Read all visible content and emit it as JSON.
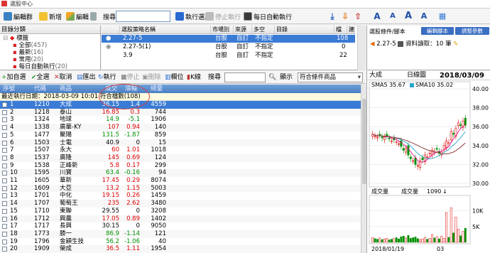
{
  "window": {
    "title": "選股中心"
  },
  "toolbar": {
    "new_folder": "編輯群",
    "add": "新增",
    "edit": "編輯",
    "delete_icon": "trash-icon",
    "search_label": "搜尋",
    "search_value": "",
    "run": "執行選股",
    "stop": "停止執行",
    "auto_run": "每日自動執行"
  },
  "catalog": {
    "header": "目錄分類",
    "root": "標籤",
    "items": [
      {
        "label": "全部",
        "count": "(457)"
      },
      {
        "label": "最新",
        "count": "(16)"
      },
      {
        "label": "常用",
        "count": "(20)"
      },
      {
        "label": "每日自動執行",
        "count": "(20)"
      }
    ]
  },
  "strategy": {
    "headers": [
      "選股策略名稱",
      "市場別",
      "來源",
      "多空",
      "目錄",
      "檔數",
      "建立"
    ],
    "rows": [
      {
        "name": "2.27-5",
        "market": "台股",
        "source": "自訂",
        "side": "不指定",
        "folder": "",
        "count": "108",
        "selected": true
      },
      {
        "name": "2.27-5(1)",
        "market": "台股",
        "source": "自訂",
        "side": "不指定",
        "folder": "",
        "count": "0",
        "selected": false
      },
      {
        "name": "3.9",
        "market": "台股",
        "source": "自訂",
        "side": "不指定",
        "folder": "",
        "count": "22",
        "selected": false
      }
    ]
  },
  "right_top": {
    "header": "選股條件/腳本",
    "btn_edit": "編輯腳本",
    "btn_param": "調整參數",
    "script_name": "2.27-5",
    "read_text": "資料讀取：10 筆"
  },
  "quote_toolbar": {
    "add_group": "加自選",
    "select_all": "全選",
    "cancel": "取消",
    "export": "匯出",
    "run": "執行",
    "stop": "停止",
    "delete": "刪除",
    "column": "欄位",
    "kline": "K線",
    "search": "搜尋",
    "display_label": "顯示",
    "display_value": "符合條件商品"
  },
  "list": {
    "headers": [
      "序號",
      "代碼",
      "商品",
      "成交",
      "漲幅",
      "總量"
    ],
    "update_bar": "最近執行日期：2018-03-09 10:01 符合檔數(108)",
    "rows": [
      {
        "n": "1",
        "code": "1210",
        "name": "大成",
        "price": "36.15",
        "chg": "1.4",
        "vol": "4559",
        "dir": "up",
        "sel": true
      },
      {
        "n": "2",
        "code": "1218",
        "name": "泰山",
        "price": "16.85",
        "chg": "0.3",
        "vol": "744",
        "dir": "up"
      },
      {
        "n": "3",
        "code": "1324",
        "name": "地球",
        "price": "14.9",
        "chg": "-5.1",
        "vol": "1906",
        "dir": "dn"
      },
      {
        "n": "4",
        "code": "1338",
        "name": "廣華-KY",
        "price": "107",
        "chg": "0.94",
        "vol": "140",
        "dir": "up"
      },
      {
        "n": "5",
        "code": "1477",
        "name": "聚陽",
        "price": "131.5",
        "chg": "-1.87",
        "vol": "859",
        "dir": "dn"
      },
      {
        "n": "6",
        "code": "1503",
        "name": "士電",
        "price": "40.9",
        "chg": "0",
        "vol": "15",
        "dir": "flat"
      },
      {
        "n": "7",
        "code": "1507",
        "name": "永大",
        "price": "60",
        "chg": "1.01",
        "vol": "1018",
        "dir": "up"
      },
      {
        "n": "8",
        "code": "1537",
        "name": "廣隆",
        "price": "145",
        "chg": "0.69",
        "vol": "124",
        "dir": "up"
      },
      {
        "n": "9",
        "code": "1538",
        "name": "正峰新",
        "price": "5.8",
        "chg": "0.17",
        "vol": "299",
        "dir": "up"
      },
      {
        "n": "10",
        "code": "1595",
        "name": "川寶",
        "price": "63.4",
        "chg": "-0.16",
        "vol": "94",
        "dir": "dn"
      },
      {
        "n": "11",
        "code": "1605",
        "name": "華新",
        "price": "17.45",
        "chg": "0.29",
        "vol": "8074",
        "dir": "up"
      },
      {
        "n": "12",
        "code": "1609",
        "name": "大亞",
        "price": "13.2",
        "chg": "1.15",
        "vol": "5003",
        "dir": "up"
      },
      {
        "n": "13",
        "code": "1701",
        "name": "中化",
        "price": "19.15",
        "chg": "0.26",
        "vol": "1459",
        "dir": "up"
      },
      {
        "n": "14",
        "code": "1707",
        "name": "葡萄王",
        "price": "235",
        "chg": "2.62",
        "vol": "3480",
        "dir": "up"
      },
      {
        "n": "15",
        "code": "1710",
        "name": "東聯",
        "price": "29.55",
        "chg": "0",
        "vol": "3208",
        "dir": "flat"
      },
      {
        "n": "16",
        "code": "1712",
        "name": "興農",
        "price": "17.05",
        "chg": "0.89",
        "vol": "1402",
        "dir": "up"
      },
      {
        "n": "17",
        "code": "1717",
        "name": "長興",
        "price": "30.15",
        "chg": "0",
        "vol": "9050",
        "dir": "flat"
      },
      {
        "n": "18",
        "code": "1773",
        "name": "勝一",
        "price": "86.9",
        "chg": "-1.14",
        "vol": "121",
        "dir": "dn"
      },
      {
        "n": "19",
        "code": "1796",
        "name": "金穎生技",
        "price": "56.2",
        "chg": "-1.06",
        "vol": "40",
        "dir": "dn"
      },
      {
        "n": "20",
        "code": "1909",
        "name": "榮成",
        "price": "36.5",
        "chg": "1.11",
        "vol": "1954",
        "dir": "up"
      }
    ]
  },
  "chart": {
    "stock": "大成",
    "period": "日線圖",
    "date": "2018/03/09",
    "sma5_label": "SMA5",
    "sma5_value": "35.67",
    "sma10_label": "SMA10",
    "sma10_value": "35.02",
    "vol_label": "成交量",
    "vol_label2": "成交量",
    "vol_value": "1090",
    "price_axis": [
      "40.00",
      "38.00",
      "36.00",
      "34.00",
      "32.00",
      "30.00"
    ],
    "vol_axis": [
      "10K",
      "5K"
    ],
    "x_labels": [
      "2018/01/19",
      "03"
    ],
    "colors": {
      "up": "#e00000",
      "down": "#009000",
      "sma5": "#e0108a",
      "sma10": "#2aa6c8"
    }
  }
}
